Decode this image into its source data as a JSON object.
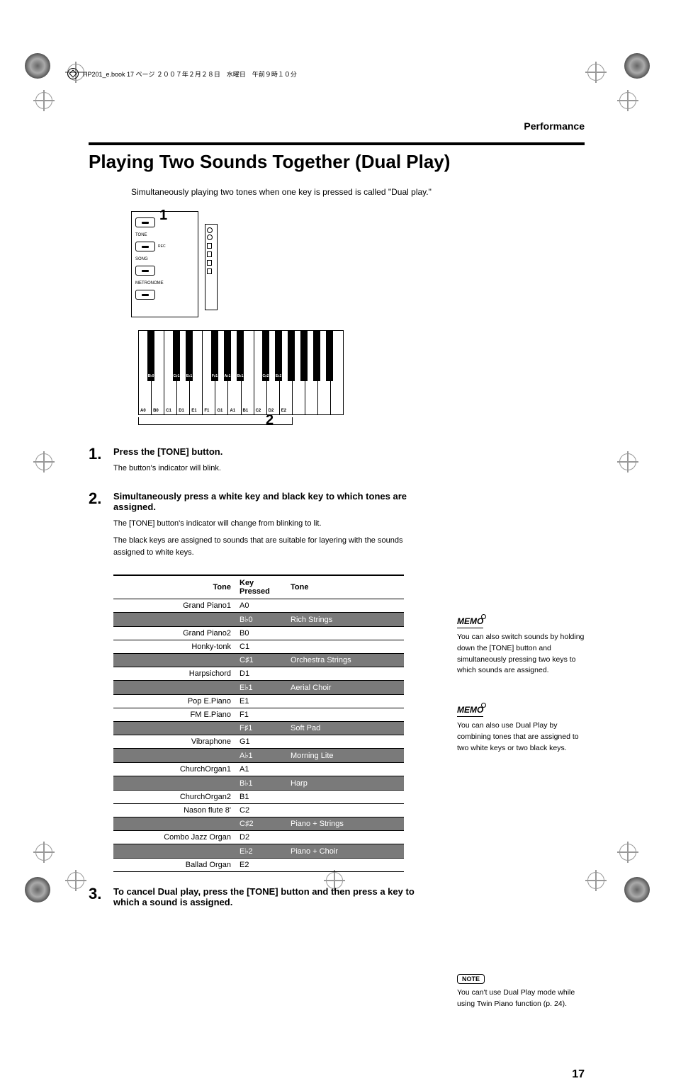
{
  "header_note": "HP201_e.book 17 ページ ２００７年２月２８日　水曜日　午前９時１０分",
  "section": "Performance",
  "title": "Playing Two Sounds Together (Dual Play)",
  "intro": "Simultaneously playing two tones when one key is pressed is called \"Dual play.\"",
  "fig": {
    "num1": "1",
    "num2": "2",
    "panel_labels": {
      "tone": "TONE",
      "song": "SONG",
      "rec": "REC",
      "metronome": "METRONOME"
    }
  },
  "white_keys": [
    "A0",
    "B0",
    "C1",
    "D1",
    "E1",
    "F1",
    "G1",
    "A1",
    "B1",
    "C2",
    "D2",
    "E2"
  ],
  "black_keys": [
    {
      "label": "B♭0",
      "pos": 13
    },
    {
      "label": "C♯1",
      "pos": 49
    },
    {
      "label": "E♭1",
      "pos": 67
    },
    {
      "label": "F♯1",
      "pos": 103
    },
    {
      "label": "A♭1",
      "pos": 121
    },
    {
      "label": "B♭1",
      "pos": 139
    },
    {
      "label": "C♯2",
      "pos": 175
    },
    {
      "label": "E♭2",
      "pos": 193
    }
  ],
  "steps": [
    {
      "num": "1.",
      "head": "Press the [TONE] button.",
      "body": [
        "The button's indicator will blink."
      ]
    },
    {
      "num": "2.",
      "head": "Simultaneously press a white key and black key to which tones are assigned.",
      "body": [
        "The [TONE] button's indicator will change from blinking to lit.",
        "The black keys are assigned to sounds that are suitable for layering with the sounds assigned to white keys."
      ]
    },
    {
      "num": "3.",
      "head": "To cancel Dual play, press the [TONE] button and then press a key to which a sound is assigned.",
      "body": []
    }
  ],
  "table": {
    "headers": [
      "Tone",
      "Key Pressed",
      "Tone"
    ],
    "rows": [
      {
        "dark": false,
        "c": [
          "Grand Piano1",
          "A0",
          ""
        ]
      },
      {
        "dark": true,
        "c": [
          "",
          "B♭0",
          "Rich Strings"
        ]
      },
      {
        "dark": false,
        "c": [
          "Grand Piano2",
          "B0",
          ""
        ]
      },
      {
        "dark": false,
        "c": [
          "Honky-tonk",
          "C1",
          ""
        ]
      },
      {
        "dark": true,
        "c": [
          "",
          "C♯1",
          "Orchestra Strings"
        ]
      },
      {
        "dark": false,
        "c": [
          "Harpsichord",
          "D1",
          ""
        ]
      },
      {
        "dark": true,
        "c": [
          "",
          "E♭1",
          "Aerial Choir"
        ]
      },
      {
        "dark": false,
        "c": [
          "Pop E.Piano",
          "E1",
          ""
        ]
      },
      {
        "dark": false,
        "c": [
          "FM E.Piano",
          "F1",
          ""
        ]
      },
      {
        "dark": true,
        "c": [
          "",
          "F♯1",
          "Soft Pad"
        ]
      },
      {
        "dark": false,
        "c": [
          "Vibraphone",
          "G1",
          ""
        ]
      },
      {
        "dark": true,
        "c": [
          "",
          "A♭1",
          "Morning Lite"
        ]
      },
      {
        "dark": false,
        "c": [
          "ChurchOrgan1",
          "A1",
          ""
        ]
      },
      {
        "dark": true,
        "c": [
          "",
          "B♭1",
          "Harp"
        ]
      },
      {
        "dark": false,
        "c": [
          "ChurchOrgan2",
          "B1",
          ""
        ]
      },
      {
        "dark": false,
        "c": [
          "Nason flute 8'",
          "C2",
          ""
        ]
      },
      {
        "dark": true,
        "c": [
          "",
          "C♯2",
          "Piano + Strings"
        ]
      },
      {
        "dark": false,
        "c": [
          "Combo Jazz Organ",
          "D2",
          ""
        ]
      },
      {
        "dark": true,
        "c": [
          "",
          "E♭2",
          "Piano + Choir"
        ]
      },
      {
        "dark": false,
        "c": [
          "Ballad Organ",
          "E2",
          ""
        ]
      }
    ]
  },
  "memos": [
    {
      "label": "MEMO",
      "text": "You can also switch sounds by holding down the [TONE] button and simultaneously pressing two keys to which sounds are assigned."
    },
    {
      "label": "MEMO",
      "text": "You can also use Dual Play by combining tones that are assigned to two white keys or two black keys."
    }
  ],
  "note": {
    "label": "NOTE",
    "text": "You can't use Dual Play mode while using Twin Piano function (p. 24)."
  },
  "pagenum": "17"
}
